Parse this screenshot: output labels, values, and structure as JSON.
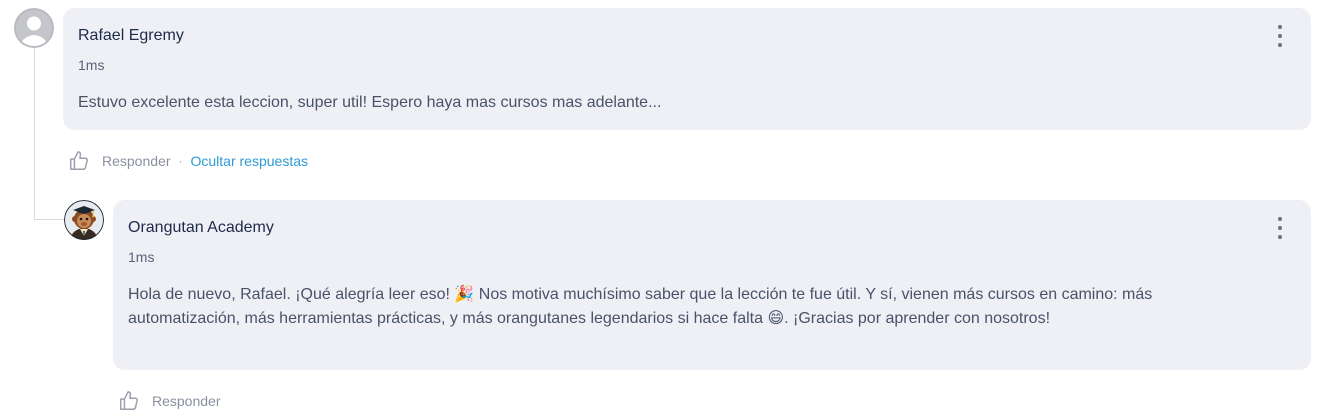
{
  "comments": [
    {
      "author": "Rafael Egremy",
      "time": "1ms",
      "body": "Estuvo excelente esta leccion, super util! Espero haya mas cursos mas adelante...",
      "reply_label": "Responder",
      "separator": "·",
      "hide_replies_label": "Ocultar respuestas"
    },
    {
      "author": "Orangutan Academy",
      "time": "1ms",
      "body": "Hola de nuevo, Rafael. ¡Qué alegría leer eso! 🎉 Nos motiva muchísimo saber que la lección te fue útil. Y sí, vienen más cursos en camino: más automatización, más herramientas prácticas, y más orangutanes legendarios si hace falta 😄. ¡Gracias por aprender con nosotros!",
      "reply_label": "Responder"
    }
  ],
  "colors": {
    "card_bg": "#eef0f6",
    "link": "#2c9bd6",
    "muted": "#8a90a0"
  },
  "icons": [
    "default-avatar-icon",
    "orangutan-avatar-icon",
    "more-vertical-icon",
    "thumbs-up-icon"
  ]
}
